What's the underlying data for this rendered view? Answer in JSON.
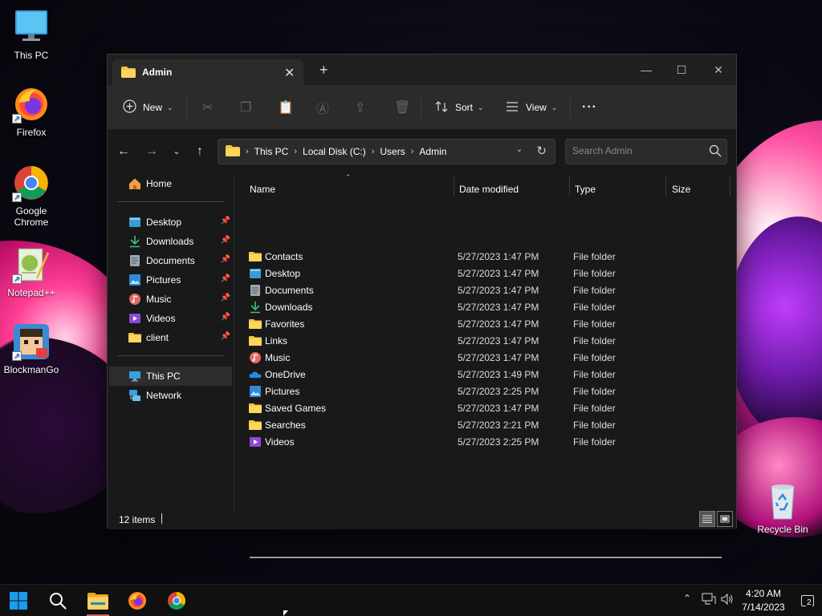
{
  "desktop": {
    "icons": [
      {
        "label": "This PC",
        "icon": "monitor-icon"
      },
      {
        "label": "Firefox",
        "icon": "firefox-icon"
      },
      {
        "label": "Google Chrome",
        "icon": "chrome-icon"
      },
      {
        "label": "Notepad++",
        "icon": "notepadpp-icon"
      },
      {
        "label": "BlockmanGo",
        "icon": "blockmango-icon"
      },
      {
        "label": "Recycle Bin",
        "icon": "recycle-bin-icon"
      }
    ]
  },
  "window": {
    "tab_title": "Admin",
    "toolbar": {
      "new_label": "New",
      "sort_label": "Sort",
      "view_label": "View",
      "more_label": "···"
    },
    "address": {
      "crumbs": [
        "This PC",
        "Local Disk (C:)",
        "Users",
        "Admin"
      ]
    },
    "search": {
      "placeholder": "Search Admin"
    },
    "nav_pane": {
      "home": "Home",
      "quick_access": [
        {
          "label": "Desktop",
          "icon": "desktop-folder-icon"
        },
        {
          "label": "Downloads",
          "icon": "downloads-icon"
        },
        {
          "label": "Documents",
          "icon": "documents-icon"
        },
        {
          "label": "Pictures",
          "icon": "pictures-icon"
        },
        {
          "label": "Music",
          "icon": "music-icon"
        },
        {
          "label": "Videos",
          "icon": "videos-icon"
        },
        {
          "label": "client",
          "icon": "folder-icon"
        }
      ],
      "this_pc": "This PC",
      "network": "Network"
    },
    "columns": {
      "name": "Name",
      "date": "Date modified",
      "type": "Type",
      "size": "Size"
    },
    "files": [
      {
        "name": "Contacts",
        "date": "5/27/2023 1:47 PM",
        "type": "File folder",
        "icon": "folder-icon"
      },
      {
        "name": "Desktop",
        "date": "5/27/2023 1:47 PM",
        "type": "File folder",
        "icon": "desktop-folder-icon"
      },
      {
        "name": "Documents",
        "date": "5/27/2023 1:47 PM",
        "type": "File folder",
        "icon": "documents-icon"
      },
      {
        "name": "Downloads",
        "date": "5/27/2023 1:47 PM",
        "type": "File folder",
        "icon": "downloads-icon"
      },
      {
        "name": "Favorites",
        "date": "5/27/2023 1:47 PM",
        "type": "File folder",
        "icon": "folder-icon"
      },
      {
        "name": "Links",
        "date": "5/27/2023 1:47 PM",
        "type": "File folder",
        "icon": "folder-icon"
      },
      {
        "name": "Music",
        "date": "5/27/2023 1:47 PM",
        "type": "File folder",
        "icon": "music-icon"
      },
      {
        "name": "OneDrive",
        "date": "5/27/2023 1:49 PM",
        "type": "File folder",
        "icon": "onedrive-icon"
      },
      {
        "name": "Pictures",
        "date": "5/27/2023 2:25 PM",
        "type": "File folder",
        "icon": "pictures-icon"
      },
      {
        "name": "Saved Games",
        "date": "5/27/2023 1:47 PM",
        "type": "File folder",
        "icon": "folder-icon"
      },
      {
        "name": "Searches",
        "date": "5/27/2023 2:21 PM",
        "type": "File folder",
        "icon": "folder-icon"
      },
      {
        "name": "Videos",
        "date": "5/27/2023 2:25 PM",
        "type": "File folder",
        "icon": "videos-icon"
      }
    ],
    "status": {
      "item_count": "12 items"
    }
  },
  "taskbar": {
    "time": "4:20 AM",
    "date": "7/14/2023",
    "notification_count": "2"
  },
  "colors": {
    "folder": "#f4c542",
    "accent": "#4cc2ff",
    "window_bg": "#191919",
    "toolbar_bg": "#2b2b2b"
  }
}
